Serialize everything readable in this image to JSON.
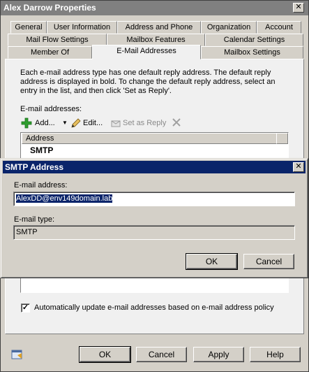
{
  "window": {
    "title": "Alex Darrow Properties",
    "close_glyph": "✕"
  },
  "tabs": {
    "row1": [
      "General",
      "User Information",
      "Address and Phone",
      "Organization",
      "Account"
    ],
    "row2": [
      "Mail Flow Settings",
      "Mailbox Features",
      "Calendar Settings"
    ],
    "row3": [
      "Member Of",
      "E-Mail Addresses",
      "Mailbox Settings"
    ],
    "active": "E-Mail Addresses"
  },
  "panel": {
    "description": "Each e-mail address type has one default reply address. The default reply address is displayed in bold. To change the default reply address, select an entry in the list, and then click 'Set as Reply'.",
    "list_label": "E-mail addresses:",
    "toolbar": {
      "add": "Add...",
      "edit": "Edit...",
      "set_as_reply": "Set as Reply"
    },
    "list_header": "Address",
    "rows": [
      "SMTP"
    ],
    "auto_update_label": "Automatically update e-mail addresses based on e-mail address policy",
    "auto_update_checked": true
  },
  "footer": {
    "ok": "OK",
    "cancel": "Cancel",
    "apply": "Apply",
    "help": "Help"
  },
  "dialog": {
    "title": "SMTP Address",
    "close_glyph": "✕",
    "email_label": "E-mail address:",
    "email_value": "AlexDD@env149domain.lab",
    "type_label": "E-mail type:",
    "type_value": "SMTP",
    "ok": "OK",
    "cancel": "Cancel"
  },
  "colors": {
    "dialog_title_bg": "#0a246a",
    "inactive_title_bg": "#808080",
    "add_icon": "#2e9e2e"
  }
}
